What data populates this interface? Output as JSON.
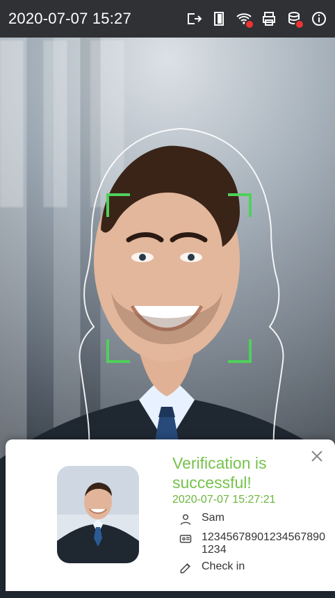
{
  "status_bar": {
    "datetime": "2020-07-07 15:27",
    "icons": [
      "exit-icon",
      "door-icon",
      "wifi-error-icon",
      "printer-icon",
      "database-error-icon",
      "info-icon"
    ]
  },
  "result": {
    "title": "Verification is successful!",
    "timestamp": "2020-07-07 15:27:21",
    "name": "Sam",
    "id": "12345678901234567890 1234",
    "action": "Check in",
    "close_icon": "close-icon"
  },
  "colors": {
    "status_bg": "#2f3135",
    "success_green": "#76c24b",
    "guide_green": "#4fd15a",
    "card_bg": "#ffffff"
  }
}
